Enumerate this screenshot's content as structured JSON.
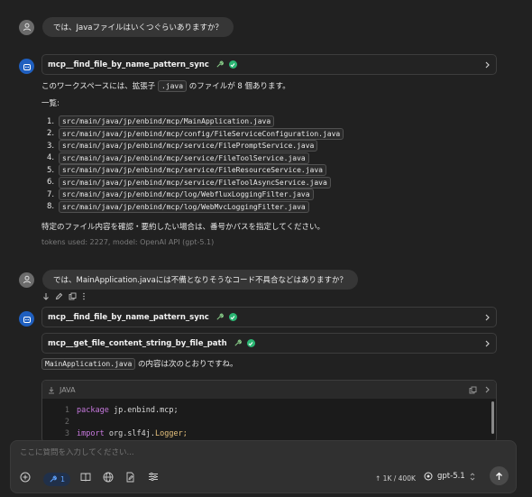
{
  "messages": {
    "user1": "では、Javaファイルはいくつぐらいありますか？",
    "tool1": "mcp__find_file_by_name_pattern_sync",
    "reply1_pre": "このワークスペースには、拡張子",
    "reply1_ext": ".java",
    "reply1_post": "のファイルが 8 個あります。",
    "list_heading": "一覧:",
    "files": [
      "src/main/java/jp/enbind/mcp/MainApplication.java",
      "src/main/java/jp/enbind/mcp/config/FileServiceConfiguration.java",
      "src/main/java/jp/enbind/mcp/service/FilePromptService.java",
      "src/main/java/jp/enbind/mcp/service/FileToolService.java",
      "src/main/java/jp/enbind/mcp/service/FileResourceService.java",
      "src/main/java/jp/enbind/mcp/service/FileToolAsyncService.java",
      "src/main/java/jp/enbind/mcp/log/WebfluxLoggingFilter.java",
      "src/main/java/jp/enbind/mcp/log/WebMvcLoggingFilter.java"
    ],
    "numbers": [
      "1.",
      "2.",
      "3.",
      "4.",
      "5.",
      "6.",
      "7.",
      "8."
    ],
    "reply1_footer": "特定のファイル内容を確認・要約したい場合は、番号かパスを指定してください。",
    "meta": "tokens used: 2227, model: OpenAI API (gpt-5.1)",
    "user2": "では、MainApplication.javaには不備となりそうなコード不具合などはありますか？",
    "tool2": "mcp__find_file_by_name_pattern_sync",
    "tool3": "mcp__get_file_content_string_by_file_path",
    "reply2_file": "MainApplication.java",
    "reply2_post": "の内容は次のとおりですね。"
  },
  "code": {
    "language": "JAVA",
    "lines": [
      {
        "num": "1",
        "kw": "package",
        "rest": " jp.enbind.mcp;",
        "cls": ""
      },
      {
        "num": "2",
        "kw": "",
        "rest": "",
        "cls": ""
      },
      {
        "num": "3",
        "kw": "import",
        "rest": " org.slf4j.",
        "cls": "Logger;"
      }
    ]
  },
  "composer": {
    "placeholder": "ここに質問を入力してください...",
    "tool_count": "1",
    "tokens": "↑ 1K / 400K",
    "model": "gpt-5.1"
  },
  "colors": {
    "accent": "#1f5fbf",
    "success": "#2bb673",
    "keyword": "#c678dd"
  }
}
